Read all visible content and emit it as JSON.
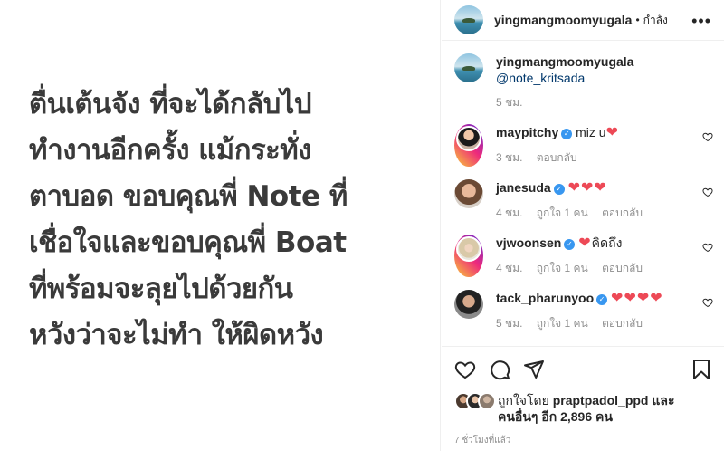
{
  "post": {
    "lines": [
      "ตื่นเต้นจัง ที่จะได้กลับไป",
      "ทำงานอีกครั้ง แม้กระทั่ง",
      "ตาบอด ขอบคุณพี่ Note ที่",
      "เชื่อใจและขอบคุณพี่ Boat",
      "ที่พร้อมจะลุยไปด้วยกัน",
      "หวังว่าจะไม่ทำ ให้ผิดหวัง"
    ]
  },
  "header": {
    "username": "yingmangmoomyugala",
    "separator": "•",
    "follow_state": "กำลัง",
    "more": "•••"
  },
  "caption": {
    "username": "yingmangmoomyugala",
    "mention": "@note_kritsada",
    "time": "5 ชม."
  },
  "comments": [
    {
      "username": "maypitchy",
      "text": "miz u",
      "hearts": "❤",
      "time": "3 ชม.",
      "likes": "",
      "reply": "ตอบกลับ"
    },
    {
      "username": "janesuda",
      "text": "",
      "hearts": "❤❤❤",
      "time": "4 ชม.",
      "likes": "ถูกใจ 1 คน",
      "reply": "ตอบกลับ"
    },
    {
      "username": "vjwoonsen",
      "text": "คิดถึง",
      "hearts": "❤",
      "time": "4 ชม.",
      "likes": "ถูกใจ 1 คน",
      "reply": "ตอบกลับ"
    },
    {
      "username": "tack_pharunyoo",
      "text": "",
      "hearts": "❤❤❤❤",
      "time": "5 ชม.",
      "likes": "ถูกใจ 1 คน",
      "reply": "ตอบกลับ"
    }
  ],
  "likes": {
    "prefix": "ถูกใจโดย",
    "user": "praptpadol_ppd",
    "and": "และ",
    "others": "คนอื่นๆ อีก 2,896 คน"
  },
  "timestamp": "7 ชั่วโมงที่แล้ว",
  "icons": {
    "like": "heart-icon",
    "comment": "comment-icon",
    "share": "share-icon",
    "save": "bookmark-icon"
  },
  "colors": {
    "heart_red": "#ed4956",
    "verified_blue": "#3897f0",
    "mention_blue": "#00376b",
    "meta_gray": "#8e8e8e"
  }
}
